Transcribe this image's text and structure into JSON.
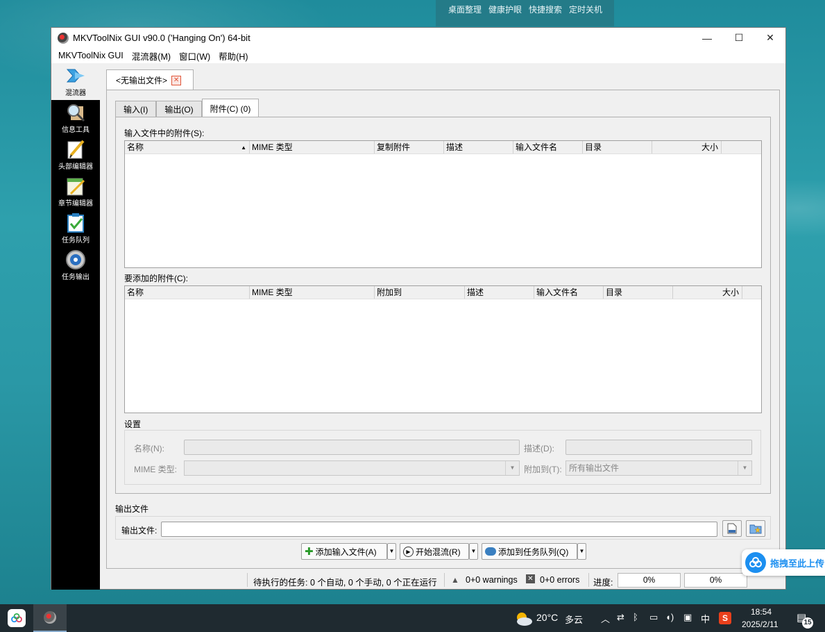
{
  "desktop": {
    "tools": [
      "桌面整理",
      "健康护眼",
      "快捷搜索",
      "定时关机"
    ]
  },
  "window": {
    "title": "MKVToolNix GUI v90.0 ('Hanging On') 64-bit",
    "controls": {
      "minimize": "—",
      "maximize": "☐",
      "close": "✕"
    }
  },
  "menubar": [
    "MKVToolNix GUI",
    "混流器(M)",
    "窗口(W)",
    "帮助(H)"
  ],
  "sidebar": [
    {
      "label": "混流器",
      "icon": "merge-icon",
      "active": true
    },
    {
      "label": "信息工具",
      "icon": "info-tool-icon"
    },
    {
      "label": "头部编辑器",
      "icon": "header-editor-icon"
    },
    {
      "label": "章节编辑器",
      "icon": "chapter-editor-icon"
    },
    {
      "label": "任务队列",
      "icon": "job-queue-icon"
    },
    {
      "label": "任务输出",
      "icon": "job-output-icon"
    }
  ],
  "doc_tab": {
    "label": "<无输出文件>"
  },
  "sub_tabs": [
    "输入(I)",
    "输出(O)",
    "附件(C) (0)"
  ],
  "attachments": {
    "existing_label": "输入文件中的附件(S):",
    "existing_columns": [
      "名称",
      "MIME 类型",
      "复制附件",
      "描述",
      "输入文件名",
      "目录",
      "大小"
    ],
    "new_label": "要添加的附件(C):",
    "new_columns": [
      "名称",
      "MIME 类型",
      "附加到",
      "描述",
      "输入文件名",
      "目录",
      "大小"
    ]
  },
  "settings": {
    "label": "设置",
    "name_label": "名称(N):",
    "description_label": "描述(D):",
    "mime_label": "MIME 类型:",
    "attach_to_label": "附加到(T):",
    "attach_to_value": "所有输出文件"
  },
  "output": {
    "section_label": "输出文件",
    "field_label": "输出文件:",
    "value": ""
  },
  "actions": {
    "add_input": "添加输入文件(A)",
    "start_mux": "开始混流(R)",
    "add_queue": "添加到任务队列(Q)"
  },
  "status": {
    "pending": "待执行的任务: 0 个自动, 0 个手动, 0 个正在运行",
    "warnings": "0+0 warnings",
    "errors": "0+0 errors",
    "progress_label": "进度:",
    "progress_1": "0%",
    "progress_2": "0%"
  },
  "upload_badge": "拖拽至此上传",
  "taskbar": {
    "weather_temp": "20°C",
    "weather_desc": "多云",
    "ime": "中",
    "time": "18:54",
    "date": "2025/2/11",
    "notification_count": "15"
  }
}
